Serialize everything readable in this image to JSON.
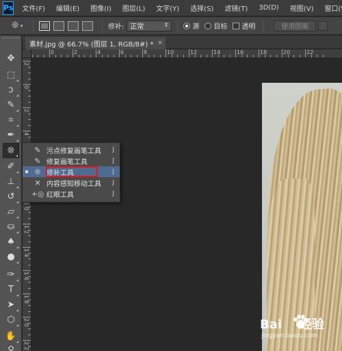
{
  "app": {
    "logo": "Ps"
  },
  "menubar": {
    "items": [
      "文件(F)",
      "编辑(E)",
      "图像(I)",
      "图层(L)",
      "文字(Y)",
      "选择(S)",
      "滤镜(T)",
      "3D(D)",
      "视图(V)",
      "窗口(W)"
    ]
  },
  "options": {
    "patch_label": "修补:",
    "patch_mode": "正常",
    "source_label": "源",
    "target_label": "目标",
    "transparent_label": "透明",
    "use_pattern_button": "使用图案"
  },
  "document": {
    "tab_title": "素材.jpg @ 66.7% (图层 1, RGB/8#) *",
    "close_glyph": "×"
  },
  "rulers": {
    "horizontal_labels": [
      "2",
      "0",
      "2",
      "4",
      "6",
      "8",
      "10",
      "12",
      "14",
      "16",
      "18",
      "20",
      "22"
    ],
    "vertical_labels": [
      "2",
      "0",
      "2",
      "4",
      "6",
      "8",
      "1 0",
      "1 2",
      "1 4",
      "1 6",
      "1 8",
      "2 0",
      "2 2"
    ]
  },
  "flyout": {
    "items": [
      {
        "icon": "spot-healing-brush-icon",
        "label": "污点修复画笔工具",
        "key": "J"
      },
      {
        "icon": "healing-brush-icon",
        "label": "修复画笔工具",
        "key": "J"
      },
      {
        "icon": "patch-tool-icon",
        "label": "修补工具",
        "key": "J"
      },
      {
        "icon": "content-aware-move-icon",
        "label": "内容感知移动工具",
        "key": "J"
      },
      {
        "icon": "red-eye-icon",
        "label": "红眼工具",
        "key": "J"
      }
    ],
    "selected_index": 2,
    "highlight_color": "#e1161f"
  },
  "watermark": {
    "brand": "Bai",
    "brand_suffix": "经验",
    "url": "jingyan.baidu.com"
  }
}
